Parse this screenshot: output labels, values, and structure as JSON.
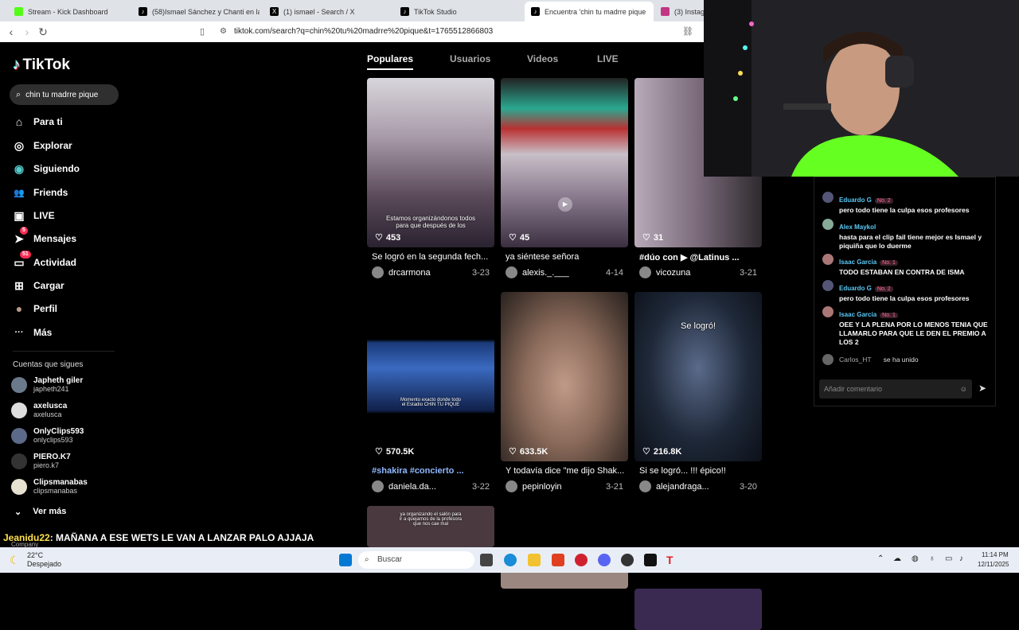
{
  "tabs": [
    {
      "title": "Stream - Kick Dashboard",
      "color": "#53fc18"
    },
    {
      "title": "(58)Ismael Sánchez y Chanti en la M",
      "color": "#000"
    },
    {
      "title": "(1) ismael - Search / X",
      "color": "#000"
    },
    {
      "title": "TikTok Studio",
      "color": "#000"
    },
    {
      "title": "Encuentra 'chin tu madrre pique",
      "color": "#000"
    },
    {
      "title": "(3) Instagra",
      "color": "#c13584"
    }
  ],
  "tab_close": "✕",
  "url": "tiktok.com/search?q=chin%20tu%20madrre%20pique&t=1765512866803",
  "logo": "TikTok",
  "search_value": "chin tu madrre pique",
  "nav": [
    {
      "label": "Para ti",
      "icon": "⌂"
    },
    {
      "label": "Explorar",
      "icon": "◎"
    },
    {
      "label": "Siguiendo",
      "icon": "◉"
    },
    {
      "label": "Friends",
      "icon": "👥"
    },
    {
      "label": "LIVE",
      "icon": "▣"
    },
    {
      "label": "Mensajes",
      "icon": "➤",
      "badge": "5"
    },
    {
      "label": "Actividad",
      "icon": "▭",
      "badge": "51"
    },
    {
      "label": "Cargar",
      "icon": "⊞"
    },
    {
      "label": "Perfil",
      "icon": "●"
    },
    {
      "label": "Más",
      "icon": "···"
    }
  ],
  "following_title": "Cuentas que sigues",
  "accounts": [
    {
      "name": "Japheth giler",
      "handle": "japheth241"
    },
    {
      "name": "axelusca",
      "handle": "axelusca"
    },
    {
      "name": "OnlyClips593",
      "handle": "onlyclips593"
    },
    {
      "name": "PIERO.K7",
      "handle": "piero.k7"
    },
    {
      "name": "Clipsmanabas",
      "handle": "clipsmanabas"
    }
  ],
  "ver_mas": "Ver más",
  "search_tabs": [
    "Populares",
    "Usuarios",
    "Videos",
    "LIVE"
  ],
  "videos": [
    {
      "likes": "453",
      "caption": "Se logró en la segunda fech...",
      "author": "drcarmona",
      "date": "3-23",
      "overlay": "Estamos organizándonos todos para que después de los",
      "bg": "#6b6272"
    },
    {
      "likes": "45",
      "caption": "ya siéntese señora",
      "author": "alexis._.___",
      "date": "4-14",
      "overlay": "",
      "bg": "#7a6f7e"
    },
    {
      "likes": "31",
      "caption": "#dúo con  ▶ @Latinus  ...",
      "author": "vicozuna",
      "date": "3-21",
      "overlay": "",
      "bg": "#5d5864"
    },
    {
      "likes": "570.5K",
      "caption": "#shakira #concierto ...",
      "author": "daniela.da...",
      "date": "3-22",
      "overlay": "Momento exacto donde todo el Estadio CHIN TU PIQUE",
      "bg": "#0a0c14"
    },
    {
      "likes": "633.5K",
      "caption": "Y todavía dice \"me dijo Shak...",
      "author": "pepinloyin",
      "date": "3-21",
      "overlay": "",
      "bg": "#8a7a6e"
    },
    {
      "likes": "216.8K",
      "caption": "Si se logró... !!! épico!!",
      "author": "alejandraga...",
      "date": "3-20",
      "overlay": "Se logró!",
      "bg": "#1a1f2a"
    }
  ],
  "bottom_overlay_1": "ya organizando el salón para ir a quejarnos de la profesora que nos cae mal",
  "chat": [
    {
      "user": "Eduardo G",
      "badge": "No. 2",
      "text": "pero todo tiene la culpa esos profesores"
    },
    {
      "user": "Alex Maykol",
      "badge": "",
      "text": "hasta para el clip fail tiene mejor es Ismael y piquiña que lo duerme"
    },
    {
      "user": "Isaac Garcia",
      "badge": "No. 1",
      "text": "TODO ESTABAN EN CONTRA DE ISMA"
    },
    {
      "user": "Eduardo G",
      "badge": "No. 2",
      "text": "pero todo tiene la culpa esos profesores"
    },
    {
      "user": "Isaac Garcia",
      "badge": "No. 1",
      "text": "OEE Y LA PLENA POR LO MENOS TENIA QUE LLAMARLO PARA QUE LE DEN EL PREMIO A LOS 2"
    }
  ],
  "join_user": "Carlos_HT",
  "join_text": "se ha unido",
  "comment_placeholder": "Añadir comentario",
  "overlay_user": "Jeanidu22",
  "overlay_msg": ": MAÑANA A ESE WETS LE VAN A LANZAR PALO AJJAJA",
  "overlay_sub": "Company",
  "weather_temp": "22°C",
  "weather_desc": "Despejado",
  "taskbar_search": "Buscar",
  "clock_time": "11:14 PM",
  "clock_date": "12/11/2025"
}
